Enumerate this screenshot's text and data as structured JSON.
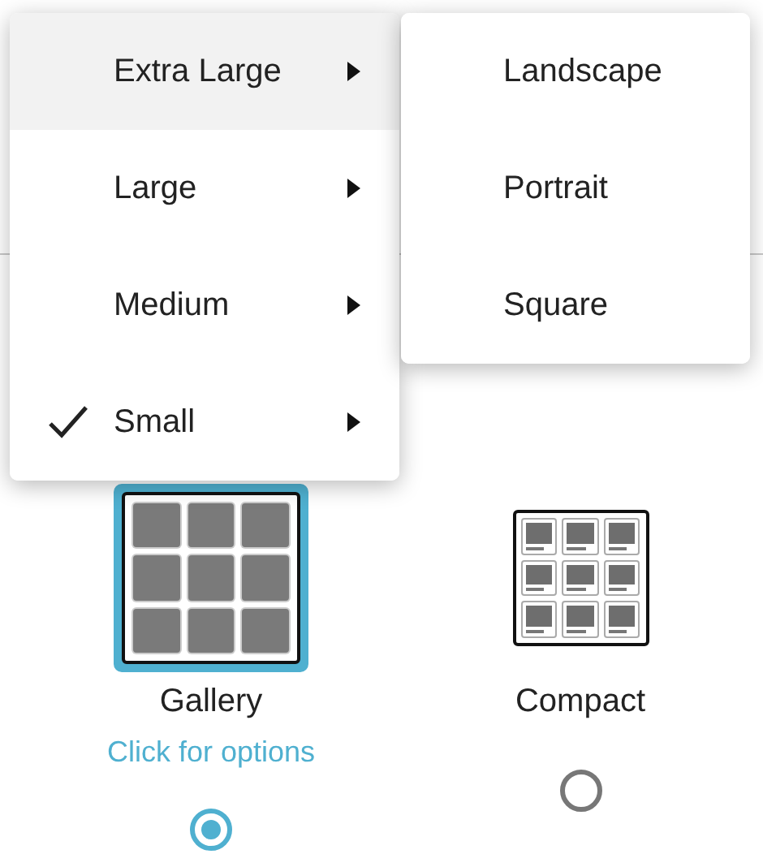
{
  "options": [
    {
      "kind": "gallery",
      "label": "Gallery",
      "hint": "Click for options",
      "selected": true
    },
    {
      "kind": "compact",
      "label": "Compact",
      "selected": false
    }
  ],
  "menu": {
    "items": [
      {
        "label": "Extra Large",
        "checked": false,
        "highlighted": true,
        "has_submenu": true
      },
      {
        "label": "Large",
        "checked": false,
        "highlighted": false,
        "has_submenu": true
      },
      {
        "label": "Medium",
        "checked": false,
        "highlighted": false,
        "has_submenu": true
      },
      {
        "label": "Small",
        "checked": true,
        "highlighted": false,
        "has_submenu": true
      }
    ]
  },
  "submenu": {
    "items": [
      {
        "label": "Landscape"
      },
      {
        "label": "Portrait"
      },
      {
        "label": "Square"
      }
    ]
  }
}
